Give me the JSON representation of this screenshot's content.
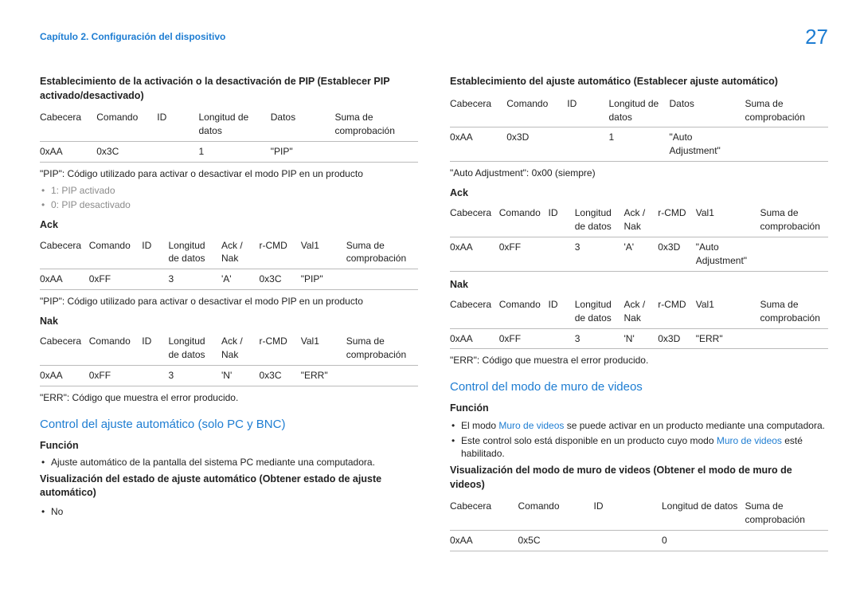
{
  "header": {
    "chapter": "Capítulo 2. Configuración del dispositivo",
    "page": "27"
  },
  "left": {
    "t1": "Establecimiento de la activación o la desactivación de PIP (Establecer PIP activado/desactivado)",
    "tab1": {
      "h": [
        "Cabecera",
        "Comando",
        "ID",
        "Longitud de datos",
        "Datos",
        "Suma de comprobación"
      ],
      "r": [
        "0xAA",
        "0x3C",
        "",
        "1",
        "\"PIP\"",
        ""
      ]
    },
    "p1": "\"PIP\": Código utilizado para activar o desactivar el modo PIP en un producto",
    "li1": "1: PIP activado",
    "li2": "0: PIP desactivado",
    "ack": "Ack",
    "tab2": {
      "h": [
        "Cabecera",
        "Comando",
        "ID",
        "Longitud de datos",
        "Ack / Nak",
        "r-CMD",
        "Val1",
        "Suma de comprobación"
      ],
      "r": [
        "0xAA",
        "0xFF",
        "",
        "3",
        "'A'",
        "0x3C",
        "\"PIP\"",
        ""
      ]
    },
    "p2": "\"PIP\": Código utilizado para activar o desactivar el modo PIP en un producto",
    "nak": "Nak",
    "tab3": {
      "h": [
        "Cabecera",
        "Comando",
        "ID",
        "Longitud de datos",
        "Ack / Nak",
        "r-CMD",
        "Val1",
        "Suma de comprobación"
      ],
      "r": [
        "0xAA",
        "0xFF",
        "",
        "3",
        "'N'",
        "0x3C",
        "\"ERR\"",
        ""
      ]
    },
    "p3": "\"ERR\": Código que muestra el error producido.",
    "h2": "Control del ajuste automático (solo PC y BNC)",
    "fun": "Función",
    "li3": "Ajuste automático de la pantalla del sistema PC mediante una computadora.",
    "t2": "Visualización del estado de ajuste automático (Obtener estado de ajuste automático)",
    "li4": "No"
  },
  "right": {
    "t1": "Establecimiento del ajuste automático (Establecer ajuste automático)",
    "tab1": {
      "h": [
        "Cabecera",
        "Comando",
        "ID",
        "Longitud de datos",
        "Datos",
        "Suma de comprobación"
      ],
      "r": [
        "0xAA",
        "0x3D",
        "",
        "1",
        "\"Auto Adjustment\"",
        ""
      ]
    },
    "p1": "\"Auto Adjustment\": 0x00 (siempre)",
    "ack": "Ack",
    "tab2": {
      "h": [
        "Cabecera",
        "Comando",
        "ID",
        "Longitud de datos",
        "Ack / Nak",
        "r-CMD",
        "Val1",
        "Suma de comprobación"
      ],
      "r": [
        "0xAA",
        "0xFF",
        "",
        "3",
        "'A'",
        "0x3D",
        "\"Auto Adjustment\"",
        ""
      ]
    },
    "nak": "Nak",
    "tab3": {
      "h": [
        "Cabecera",
        "Comando",
        "ID",
        "Longitud de datos",
        "Ack / Nak",
        "r-CMD",
        "Val1",
        "Suma de comprobación"
      ],
      "r": [
        "0xAA",
        "0xFF",
        "",
        "3",
        "'N'",
        "0x3D",
        "\"ERR\"",
        ""
      ]
    },
    "p2": "\"ERR\": Código que muestra el error producido.",
    "h2": "Control del modo de muro de videos",
    "fun": "Función",
    "li1a": "El modo ",
    "li1b": "Muro de videos",
    "li1c": " se puede activar en un producto mediante una computadora.",
    "li2a": "Este control solo está disponible en un producto cuyo modo ",
    "li2b": "Muro de videos",
    "li2c": " esté habilitado.",
    "t2": "Visualización del modo de muro de videos (Obtener el modo de muro de videos)",
    "tab4": {
      "h": [
        "Cabecera",
        "Comando",
        "ID",
        "Longitud de datos",
        "Suma de comprobación"
      ],
      "r": [
        "0xAA",
        "0x5C",
        "",
        "0",
        ""
      ]
    }
  }
}
